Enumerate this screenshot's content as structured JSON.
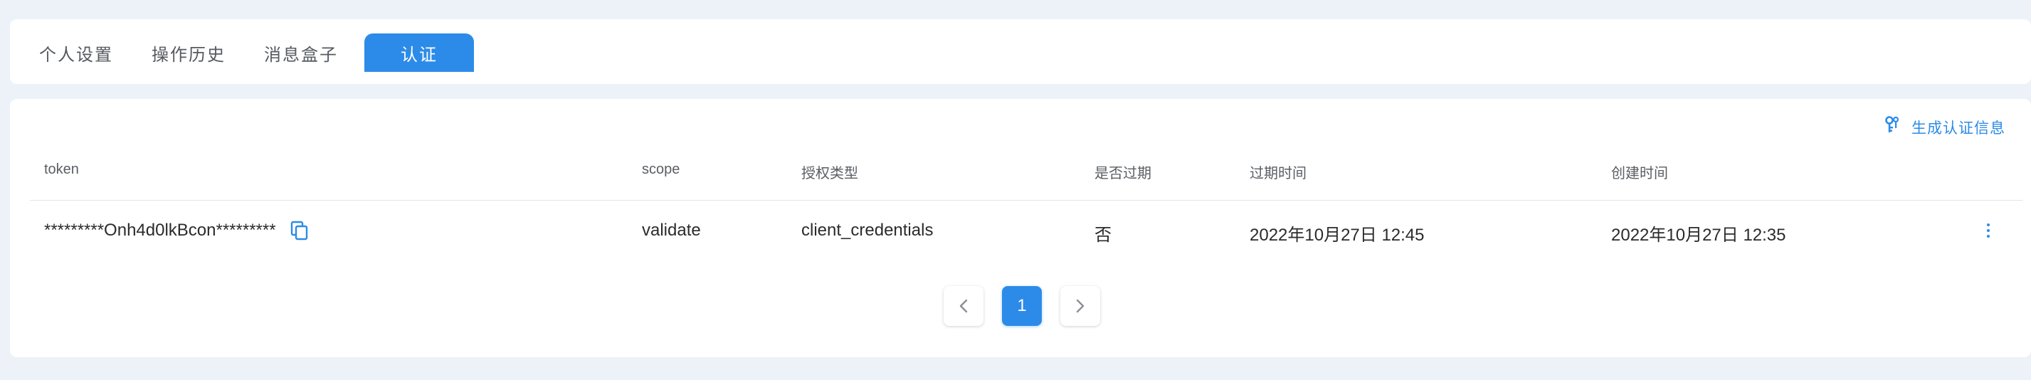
{
  "tabs": [
    {
      "label": "个人设置",
      "active": false
    },
    {
      "label": "操作历史",
      "active": false
    },
    {
      "label": "消息盒子",
      "active": false
    },
    {
      "label": "认证",
      "active": true
    }
  ],
  "toolbar": {
    "generate_label": "生成认证信息",
    "generate_icon": "key-icon"
  },
  "table": {
    "columns": [
      "token",
      "scope",
      "授权类型",
      "是否过期",
      "过期时间",
      "创建时间"
    ],
    "rows": [
      {
        "token": "*********Onh4d0lkBcon*********",
        "scope": "validate",
        "grant_type": "client_credentials",
        "expired": "否",
        "expires_at": "2022年10月27日 12:45",
        "created_at": "2022年10月27日 12:35"
      }
    ]
  },
  "pagination": {
    "current_page": "1",
    "prev_icon": "chevron-left-icon",
    "next_icon": "chevron-right-icon"
  },
  "colors": {
    "accent": "#2c8be8",
    "background": "#edf2f9",
    "card": "#ffffff"
  }
}
